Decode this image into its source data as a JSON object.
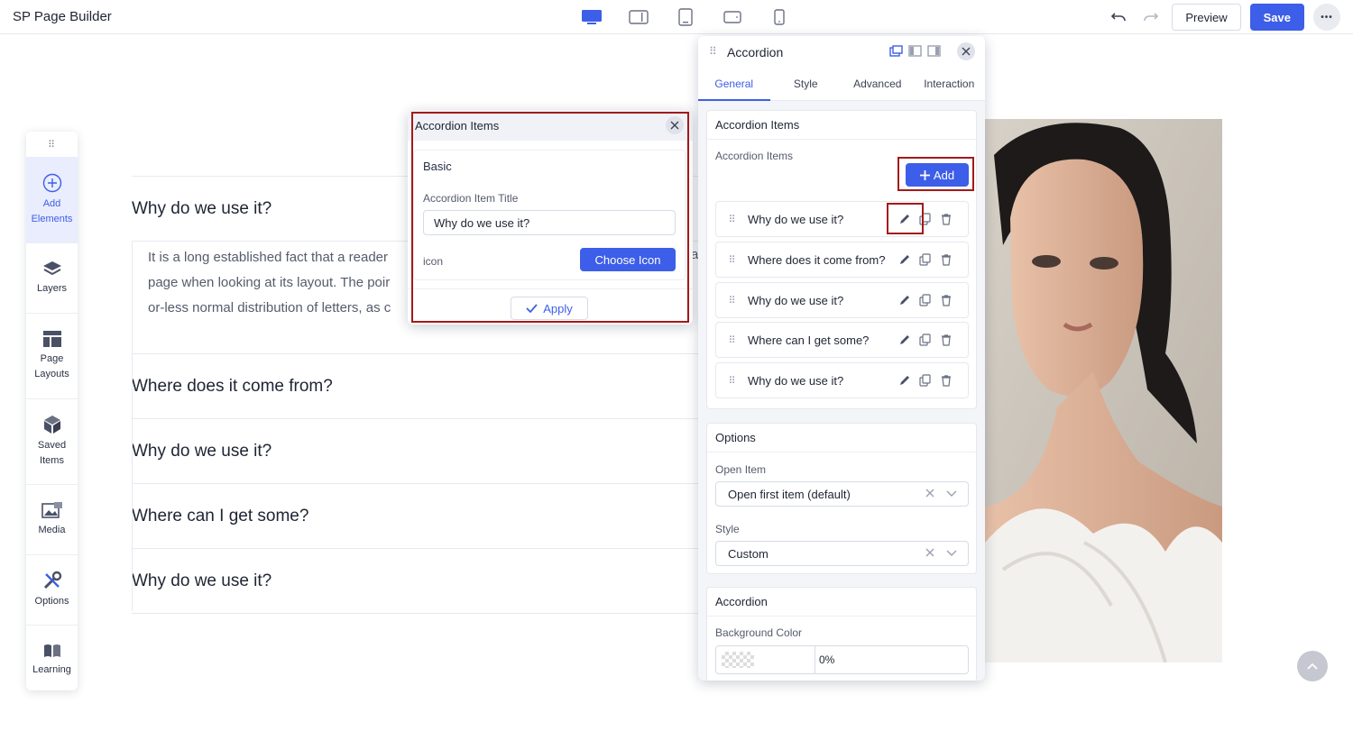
{
  "app": {
    "title": "SP Page Builder"
  },
  "devices": [
    "desktop",
    "tablet-landscape",
    "tablet",
    "mobile-landscape",
    "mobile"
  ],
  "toolbar": {
    "preview_label": "Preview",
    "save_label": "Save",
    "more_label": "•••"
  },
  "sidebar": {
    "items": [
      {
        "label_1": "Add",
        "label_2": "Elements",
        "icon": "plus-circle-icon"
      },
      {
        "label_1": "Layers",
        "label_2": "",
        "icon": "layers-icon"
      },
      {
        "label_1": "Page",
        "label_2": "Layouts",
        "icon": "layout-icon"
      },
      {
        "label_1": "Saved",
        "label_2": "Items",
        "icon": "cube-icon"
      },
      {
        "label_1": "Media",
        "label_2": "",
        "icon": "image-icon"
      },
      {
        "label_1": "Options",
        "label_2": "",
        "icon": "tools-icon"
      },
      {
        "label_1": "Learning",
        "label_2": "",
        "icon": "book-icon"
      }
    ]
  },
  "canvas": {
    "accordion": [
      {
        "title": "Why do we use it?",
        "body_lines": [
          "It is a long established fact that a reader",
          "page when looking at its layout. The poir",
          "or-less normal distribution of letters, as c"
        ]
      },
      {
        "title": "Where does it come from?"
      },
      {
        "title": "Why do we use it?"
      },
      {
        "title": "Where can I get some?"
      },
      {
        "title": "Why do we use it?"
      }
    ],
    "partial_text": "a"
  },
  "modal": {
    "title": "Accordion Items",
    "section": "Basic",
    "field_label": "Accordion Item Title",
    "field_value": "Why do we use it?",
    "icon_label": "icon",
    "choose_icon_label": "Choose Icon",
    "apply_label": "Apply"
  },
  "panel": {
    "title": "Accordion",
    "tabs": [
      "General",
      "Style",
      "Advanced",
      "Interaction"
    ],
    "items_card": {
      "title": "Accordion Items",
      "label": "Accordion Items",
      "add_label": "Add",
      "items": [
        "Why do we use it?",
        "Where does it come from?",
        "Why do we use it?",
        "Where can I get some?",
        "Why do we use it?"
      ]
    },
    "options_card": {
      "title": "Options",
      "open_item_label": "Open Item",
      "open_item_value": "Open first item (default)",
      "style_label": "Style",
      "style_value": "Custom"
    },
    "accordion_card": {
      "title": "Accordion",
      "bg_label": "Background Color",
      "bg_opacity": "0%"
    }
  },
  "colors": {
    "accent": "#3d5ee8",
    "highlight": "#a31a1a"
  }
}
